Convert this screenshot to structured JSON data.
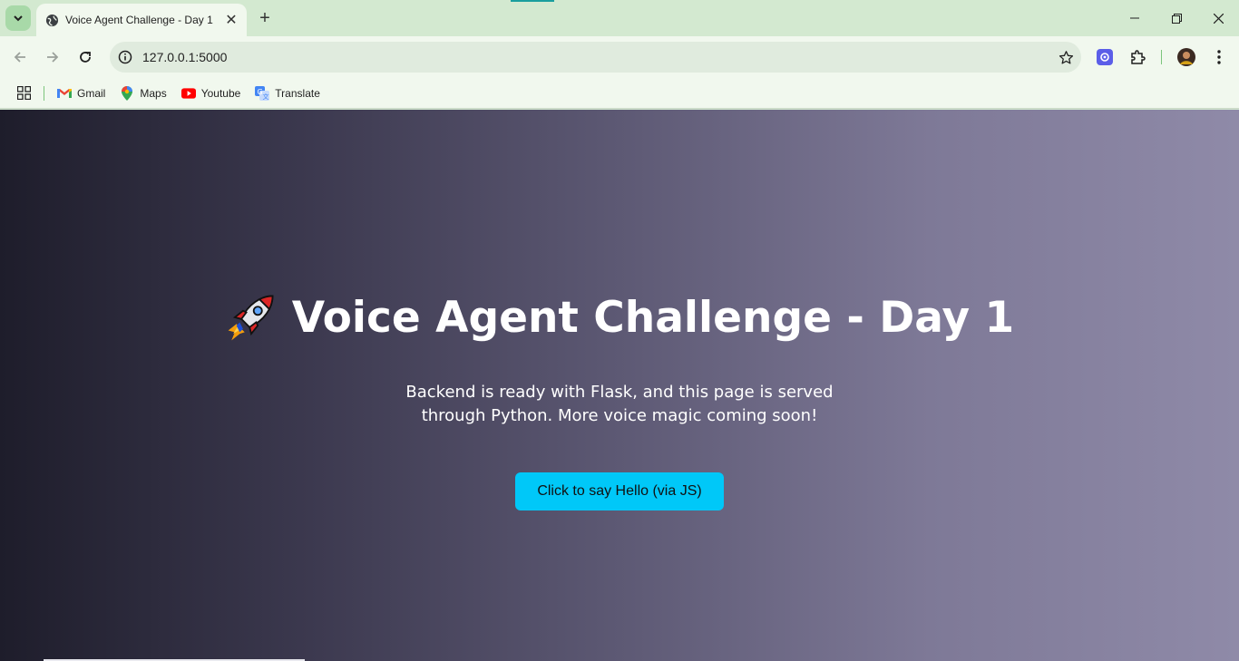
{
  "browser": {
    "tab": {
      "title": "Voice Agent Challenge - Day 1",
      "close_glyph": "✕"
    },
    "new_tab_glyph": "+",
    "address": {
      "url": "127.0.0.1:5000"
    },
    "bookmarks": [
      {
        "label": "Gmail",
        "icon": "gmail-icon"
      },
      {
        "label": "Maps",
        "icon": "maps-icon"
      },
      {
        "label": "Youtube",
        "icon": "youtube-icon"
      },
      {
        "label": "Translate",
        "icon": "translate-icon"
      }
    ]
  },
  "page": {
    "title": "Voice Agent Challenge - Day 1",
    "subtitle": "Backend is ready with Flask, and this page is served through Python. More voice magic coming soon!",
    "button_label": "Click to say Hello (via JS)"
  },
  "colors": {
    "chrome_frame": "#d3e9d0",
    "toolbar": "#f1f8ee",
    "button": "#00c8f8",
    "gradient_start": "#1e1d2b",
    "gradient_end": "#8f8aa8"
  }
}
